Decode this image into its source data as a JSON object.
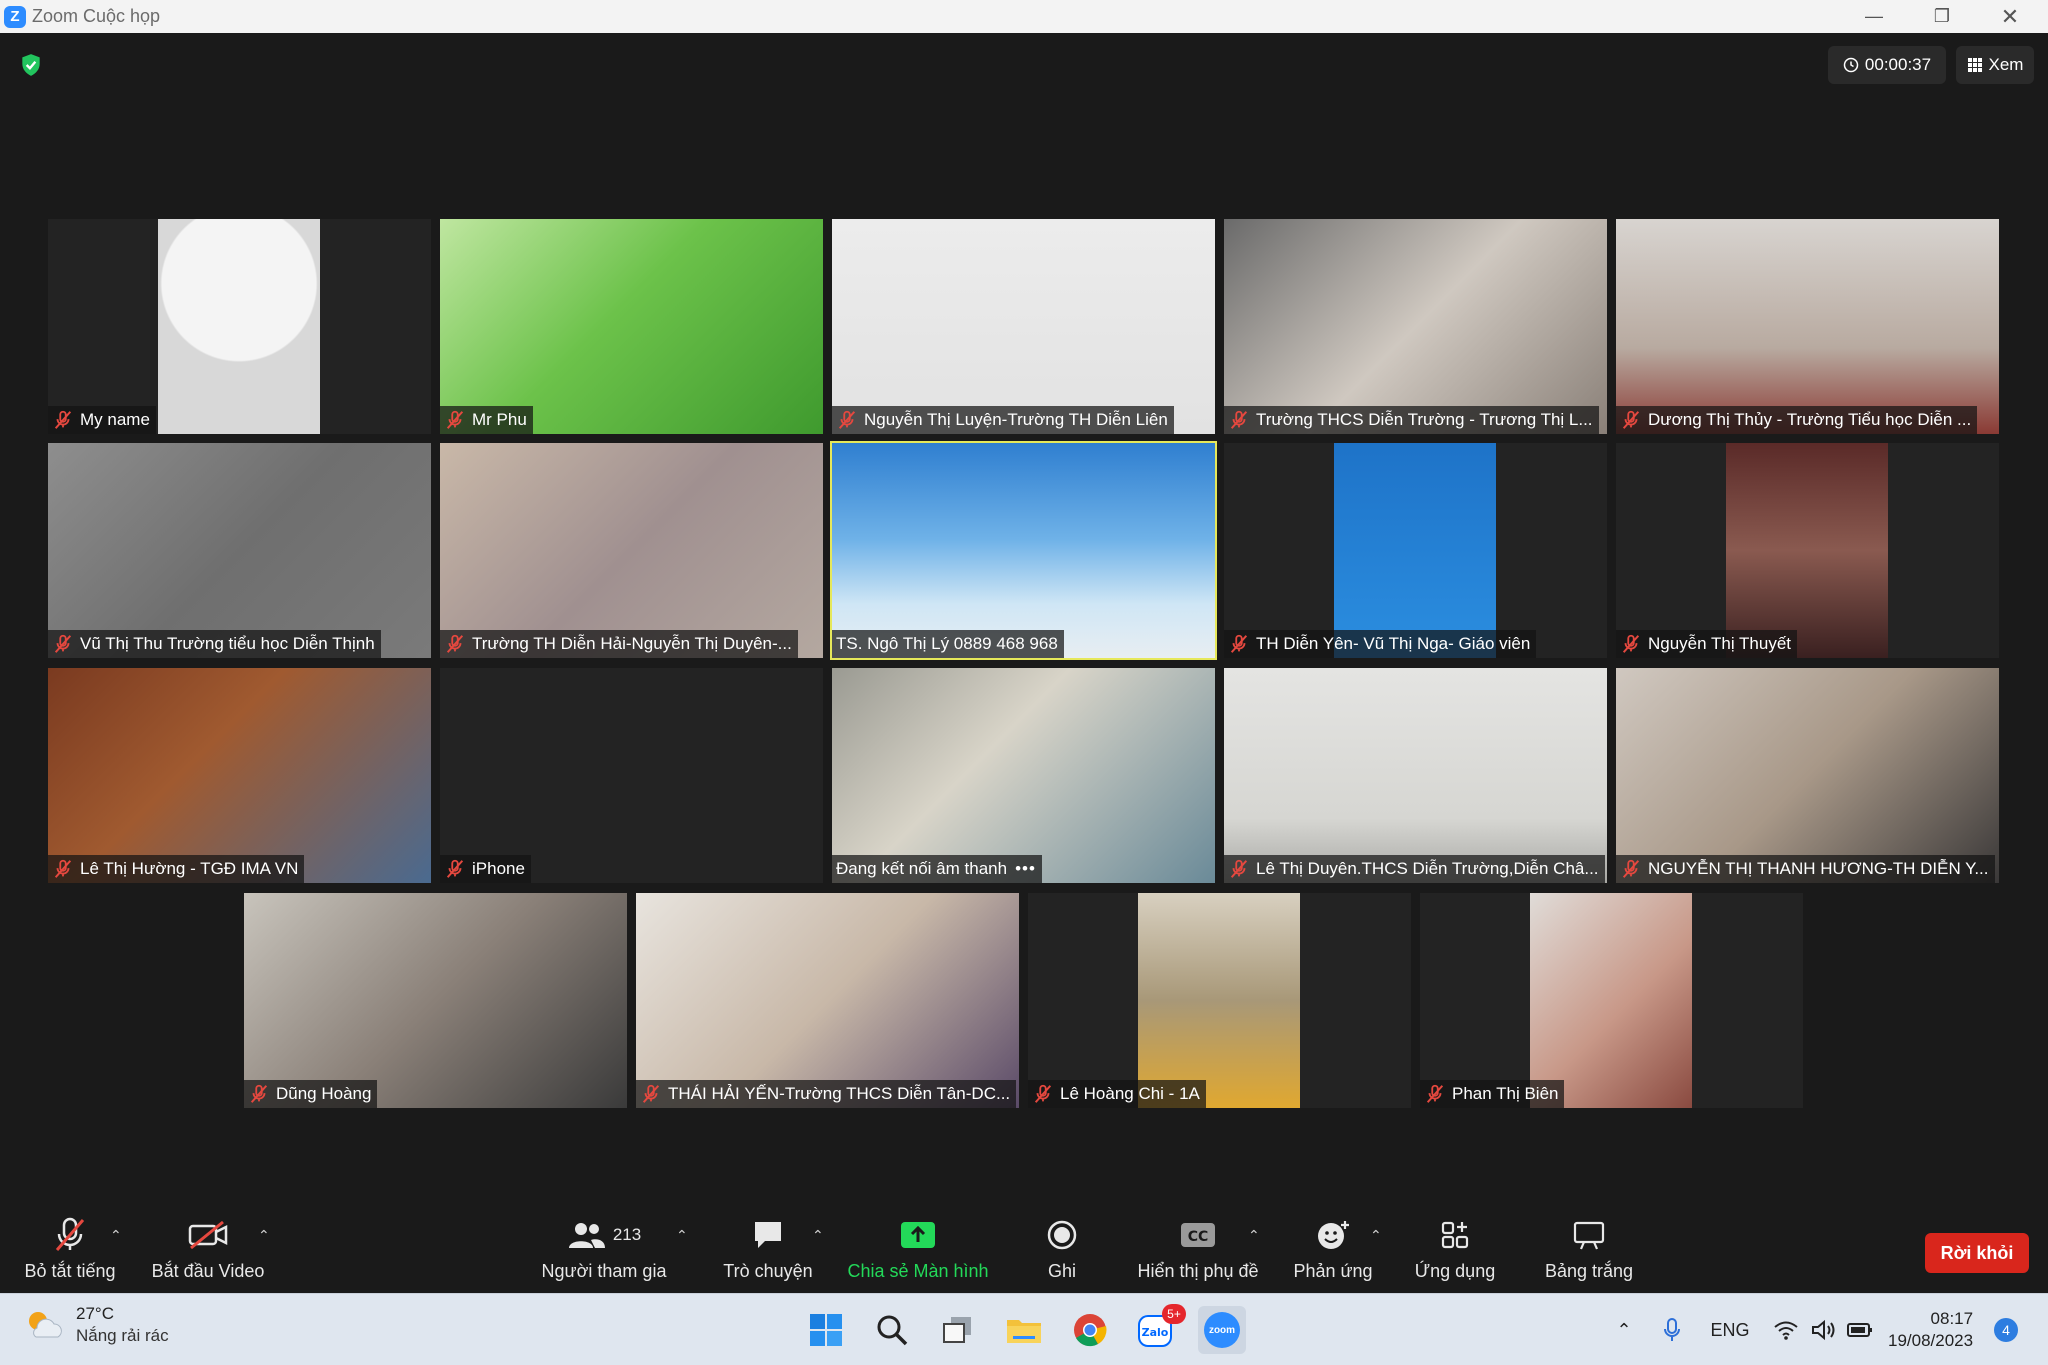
{
  "window": {
    "title": "Zoom Cuộc họp"
  },
  "topbar": {
    "timer": "00:00:37",
    "view_label": "Xem"
  },
  "tiles": [
    {
      "name": "My name"
    },
    {
      "name": "Mr Phu"
    },
    {
      "name": "Nguyễn Thị Luyện-Trường TH Diễn Liên"
    },
    {
      "name": "Trường THCS Diễn Trường - Trương Thị L..."
    },
    {
      "name": "Dương Thị Thủy - Trường Tiểu học Diễn ..."
    },
    {
      "name": "Vũ Thị Thu Trường tiểu học Diễn Thịnh"
    },
    {
      "name": "Trường TH Diễn Hải-Nguyễn Thị Duyên-..."
    },
    {
      "name": "TS. Ngô Thị Lý 0889 468 968"
    },
    {
      "name": "TH Diễn Yên- Vũ Thị Nga- Giáo viên"
    },
    {
      "name": "Nguyễn Thị Thuyết"
    },
    {
      "name": "Lê Thị Hường - TGĐ IMA VN"
    },
    {
      "name": "iPhone"
    },
    {
      "name": "Đang kết nối âm thanh"
    },
    {
      "name": "Lê Thị Duyên.THCS Diễn Trường,Diễn Châ..."
    },
    {
      "name": "NGUYỄN THỊ THANH HƯƠNG-TH DIỄN Y..."
    },
    {
      "name": "Dũng Hoàng"
    },
    {
      "name": "THÁI HẢI YẾN-Trường THCS Diễn Tân-DC..."
    },
    {
      "name": "Lê Hoàng Chi - 1A"
    },
    {
      "name": "Phan Thị Biên"
    }
  ],
  "toolbar": {
    "mute": "Bỏ tắt tiếng",
    "video": "Bắt đầu Video",
    "participants": "Người tham gia",
    "participants_count": "213",
    "chat": "Trò chuyện",
    "share": "Chia sẻ Màn hình",
    "record": "Ghi",
    "captions": "Hiển thị phụ đề",
    "reactions": "Phản ứng",
    "apps": "Ứng dụng",
    "whiteboard": "Bảng trắng",
    "leave": "Rời khỏi"
  },
  "taskbar": {
    "temperature": "27°C",
    "weather": "Nắng rải rác",
    "language": "ENG",
    "time": "08:17",
    "date": "19/08/2023",
    "notification_count": "4",
    "zalo_badge": "5+",
    "zoom_icon_label": "zoom"
  },
  "colors": {
    "accent_green": "#23d959",
    "leave_red": "#d9261c",
    "active_speaker": "#e6e85a",
    "zoom_blue": "#2d8cff"
  }
}
